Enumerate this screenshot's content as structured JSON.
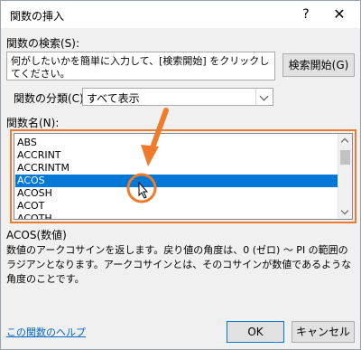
{
  "window": {
    "title": "関数の挿入",
    "help_glyph": "?",
    "close_glyph": "✕"
  },
  "search": {
    "label": "関数の検索(S):",
    "value": "何がしたいかを簡単に入力して、[検索開始] をクリックしてください。",
    "button_label": "検索開始(G)"
  },
  "category": {
    "label": "関数の分類(C):",
    "selected": "すべて表示"
  },
  "function_list": {
    "label": "関数名(N):",
    "items": [
      "ABS",
      "ACCRINT",
      "ACCRINTM",
      "ACOS",
      "ACOSH",
      "ACOT",
      "ACOTH"
    ],
    "selected_index": 3
  },
  "details": {
    "syntax": "ACOS(数値)",
    "description": "数値のアークコサインを返します。戻り値の角度は、0 (ゼロ) ～ PI の範囲のラジアンとなります。アークコサインとは、そのコサインが数値であるような角度のことです。"
  },
  "footer": {
    "help_link": "この関数のヘルプ",
    "ok_label": "OK",
    "cancel_label": "キャンセル"
  },
  "colors": {
    "accent": "#ef7b2c",
    "selection": "#0078d7"
  }
}
